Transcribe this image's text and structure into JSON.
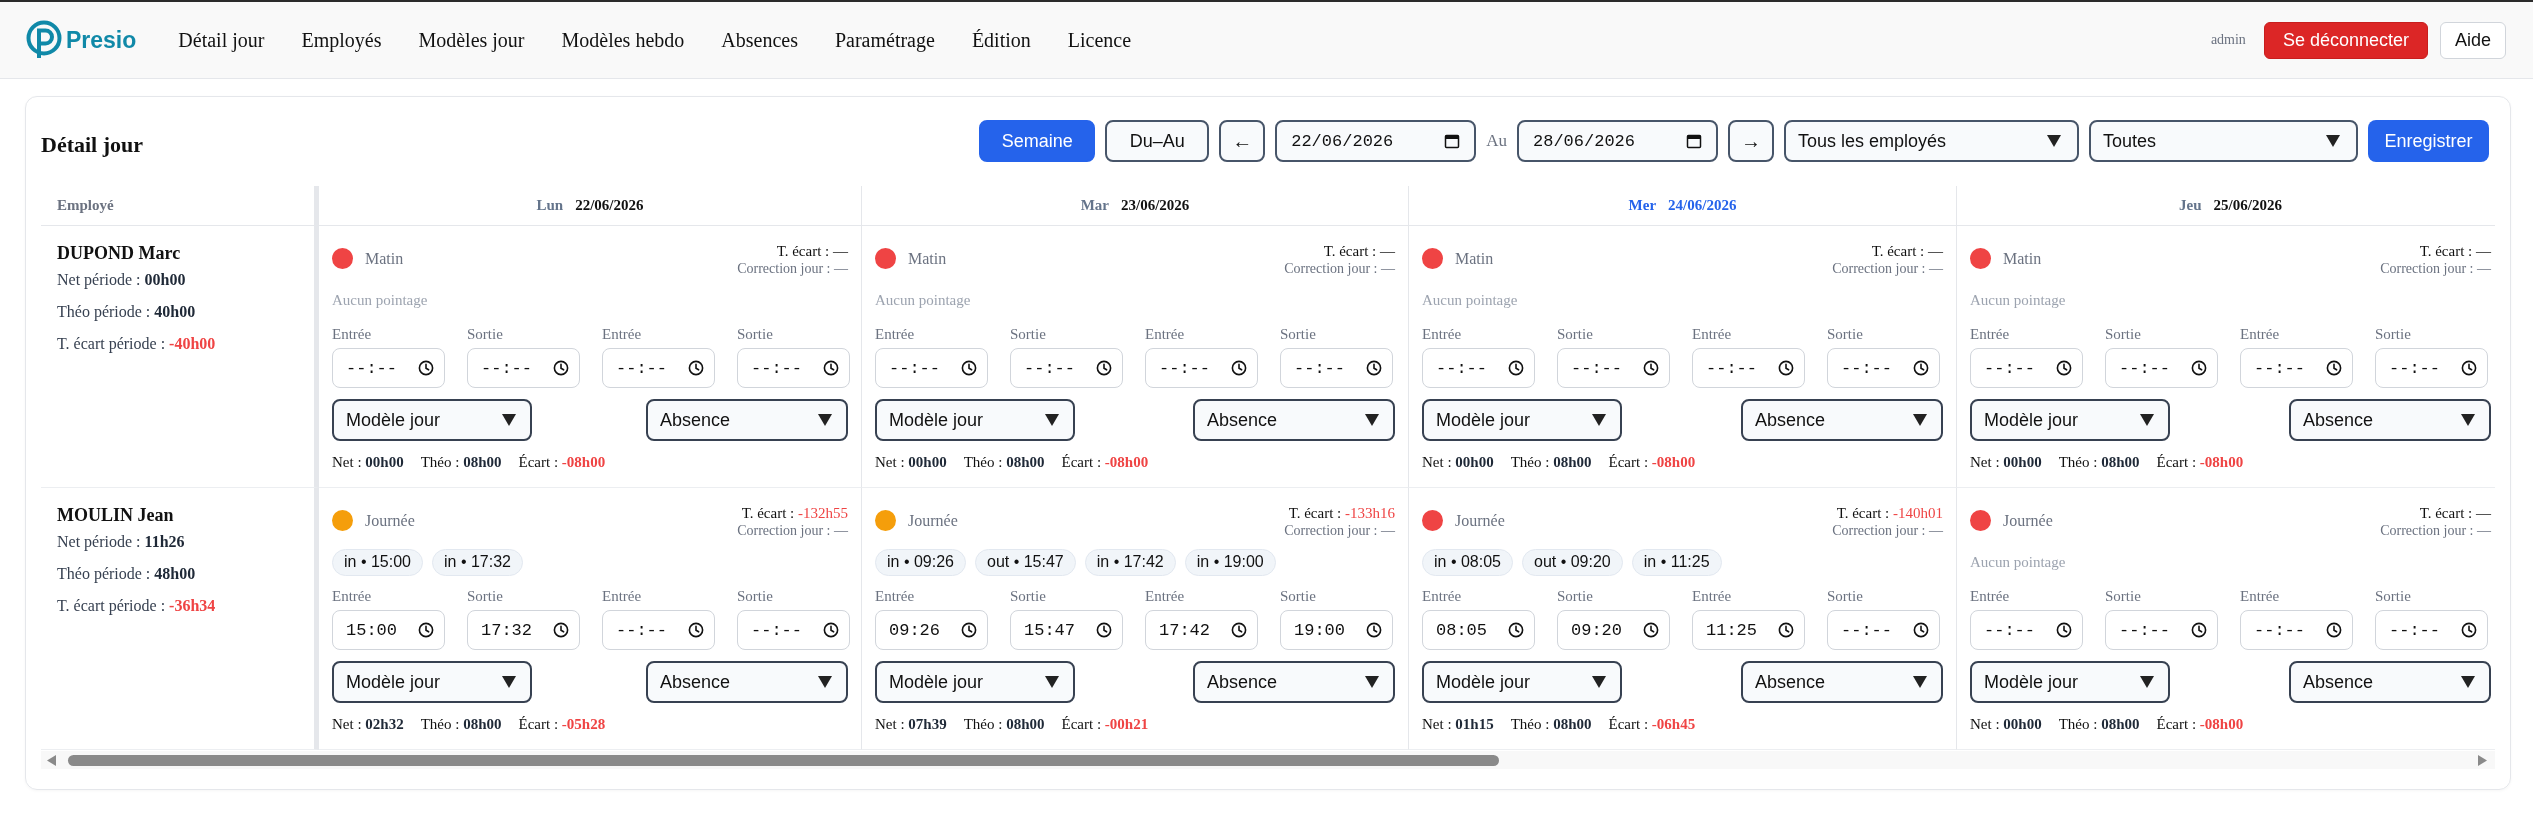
{
  "navbar": {
    "brand": "Presio",
    "links": [
      "Détail jour",
      "Employés",
      "Modèles jour",
      "Modèles hebdo",
      "Absences",
      "Paramétrage",
      "Édition",
      "Licence"
    ],
    "user": "admin",
    "logout_button": "Se déconnecter",
    "help_button": "Aide"
  },
  "page": {
    "title": "Détail jour",
    "mode_buttons": [
      {
        "label": "Semaine",
        "selected": true
      },
      {
        "label": "Du–Au",
        "selected": false
      }
    ],
    "prev_button": "←",
    "start_date": "22/06/2026",
    "range_separator": "Au",
    "end_date": "28/06/2026",
    "next_button": "→",
    "employee_filter": "Tous les employés",
    "category_filter": "Toutes",
    "save_button": "Enregistrer"
  },
  "table": {
    "employee_header": "Employé",
    "days": [
      {
        "weekday": "Lun",
        "date": "22/06/2026",
        "today": false
      },
      {
        "weekday": "Mar",
        "date": "23/06/2026",
        "today": false
      },
      {
        "weekday": "Mer",
        "date": "24/06/2026",
        "today": true
      },
      {
        "weekday": "Jeu",
        "date": "25/06/2026",
        "today": false
      }
    ],
    "rows": [
      {
        "name": "DUPOND Marc",
        "stats": [
          {
            "label": "Net période :",
            "value": "00h00",
            "negative": false
          },
          {
            "label": "Théo période :",
            "value": "40h00",
            "negative": false
          },
          {
            "label": "T. écart période :",
            "value": "-40h00",
            "negative": true
          }
        ],
        "cells": [
          {
            "color": "#ef4444",
            "shift": "Matin",
            "gap": {
              "label": "T. écart :",
              "value": "—",
              "negative": false
            },
            "correction": "Correction jour : —",
            "note": "Aucun pointage",
            "times": [
              {
                "label": "Entrée",
                "placeholder": "--:--"
              },
              {
                "label": "Sortie",
                "placeholder": "--:--"
              },
              {
                "label": "Entrée",
                "placeholder": "--:--"
              },
              {
                "label": "Sortie",
                "placeholder": "--:--"
              }
            ],
            "model": "Modèle jour",
            "absence": "Absence",
            "totals": [
              {
                "label": "Net :",
                "value": "00h00",
                "negative": false
              },
              {
                "label": "Théo :",
                "value": "08h00",
                "negative": false
              },
              {
                "label": "Écart :",
                "value": "-08h00",
                "negative": true
              }
            ]
          },
          {
            "color": "#ef4444",
            "shift": "Matin",
            "gap": {
              "label": "T. écart :",
              "value": "—",
              "negative": false
            },
            "correction": "Correction jour : —",
            "note": "Aucun pointage",
            "times": [
              {
                "label": "Entrée",
                "placeholder": "--:--"
              },
              {
                "label": "Sortie",
                "placeholder": "--:--"
              },
              {
                "label": "Entrée",
                "placeholder": "--:--"
              },
              {
                "label": "Sortie",
                "placeholder": "--:--"
              }
            ],
            "model": "Modèle jour",
            "absence": "Absence",
            "totals": [
              {
                "label": "Net :",
                "value": "00h00",
                "negative": false
              },
              {
                "label": "Théo :",
                "value": "08h00",
                "negative": false
              },
              {
                "label": "Écart :",
                "value": "-08h00",
                "negative": true
              }
            ]
          },
          {
            "color": "#ef4444",
            "shift": "Matin",
            "gap": {
              "label": "T. écart :",
              "value": "—",
              "negative": false
            },
            "correction": "Correction jour : —",
            "note": "Aucun pointage",
            "times": [
              {
                "label": "Entrée",
                "placeholder": "--:--"
              },
              {
                "label": "Sortie",
                "placeholder": "--:--"
              },
              {
                "label": "Entrée",
                "placeholder": "--:--"
              },
              {
                "label": "Sortie",
                "placeholder": "--:--"
              }
            ],
            "model": "Modèle jour",
            "absence": "Absence",
            "totals": [
              {
                "label": "Net :",
                "value": "00h00",
                "negative": false
              },
              {
                "label": "Théo :",
                "value": "08h00",
                "negative": false
              },
              {
                "label": "Écart :",
                "value": "-08h00",
                "negative": true
              }
            ]
          },
          {
            "color": "#ef4444",
            "shift": "Matin",
            "gap": {
              "label": "T. écart :",
              "value": "—",
              "negative": false
            },
            "correction": "Correction jour : —",
            "note": "Aucun pointage",
            "times": [
              {
                "label": "Entrée",
                "placeholder": "--:--"
              },
              {
                "label": "Sortie",
                "placeholder": "--:--"
              },
              {
                "label": "Entrée",
                "placeholder": "--:--"
              },
              {
                "label": "Sortie",
                "placeholder": "--:--"
              }
            ],
            "model": "Modèle jour",
            "absence": "Absence",
            "totals": [
              {
                "label": "Net :",
                "value": "00h00",
                "negative": false
              },
              {
                "label": "Théo :",
                "value": "08h00",
                "negative": false
              },
              {
                "label": "Écart :",
                "value": "-08h00",
                "negative": true
              }
            ]
          }
        ]
      },
      {
        "name": "MOULIN Jean",
        "stats": [
          {
            "label": "Net période :",
            "value": "11h26",
            "negative": false
          },
          {
            "label": "Théo période :",
            "value": "48h00",
            "negative": false
          },
          {
            "label": "T. écart période :",
            "value": "-36h34",
            "negative": true
          }
        ],
        "cells": [
          {
            "color": "#f59e0b",
            "shift": "Journée",
            "gap": {
              "label": "T. écart :",
              "value": "-132h55",
              "negative": true
            },
            "correction": "Correction jour : —",
            "punches": [
              "in • 15:00",
              "in • 17:32"
            ],
            "times": [
              {
                "label": "Entrée",
                "value": "15:00"
              },
              {
                "label": "Sortie",
                "value": "17:32"
              },
              {
                "label": "Entrée",
                "placeholder": "--:--"
              },
              {
                "label": "Sortie",
                "placeholder": "--:--"
              }
            ],
            "model": "Modèle jour",
            "absence": "Absence",
            "totals": [
              {
                "label": "Net :",
                "value": "02h32",
                "negative": false
              },
              {
                "label": "Théo :",
                "value": "08h00",
                "negative": false
              },
              {
                "label": "Écart :",
                "value": "-05h28",
                "negative": true
              }
            ]
          },
          {
            "color": "#f59e0b",
            "shift": "Journée",
            "gap": {
              "label": "T. écart :",
              "value": "-133h16",
              "negative": true
            },
            "correction": "Correction jour : —",
            "punches": [
              "in • 09:26",
              "out • 15:47",
              "in • 17:42",
              "in • 19:00"
            ],
            "times": [
              {
                "label": "Entrée",
                "value": "09:26"
              },
              {
                "label": "Sortie",
                "value": "15:47"
              },
              {
                "label": "Entrée",
                "value": "17:42"
              },
              {
                "label": "Sortie",
                "value": "19:00"
              }
            ],
            "model": "Modèle jour",
            "absence": "Absence",
            "totals": [
              {
                "label": "Net :",
                "value": "07h39",
                "negative": false
              },
              {
                "label": "Théo :",
                "value": "08h00",
                "negative": false
              },
              {
                "label": "Écart :",
                "value": "-00h21",
                "negative": true
              }
            ]
          },
          {
            "color": "#ef4444",
            "shift": "Journée",
            "gap": {
              "label": "T. écart :",
              "value": "-140h01",
              "negative": true
            },
            "correction": "Correction jour : —",
            "punches": [
              "in • 08:05",
              "out • 09:20",
              "in • 11:25"
            ],
            "times": [
              {
                "label": "Entrée",
                "value": "08:05"
              },
              {
                "label": "Sortie",
                "value": "09:20"
              },
              {
                "label": "Entrée",
                "value": "11:25"
              },
              {
                "label": "Sortie",
                "placeholder": "--:--"
              }
            ],
            "model": "Modèle jour",
            "absence": "Absence",
            "totals": [
              {
                "label": "Net :",
                "value": "01h15",
                "negative": false
              },
              {
                "label": "Théo :",
                "value": "08h00",
                "negative": false
              },
              {
                "label": "Écart :",
                "value": "-06h45",
                "negative": true
              }
            ]
          },
          {
            "color": "#ef4444",
            "shift": "Journée",
            "gap": {
              "label": "T. écart :",
              "value": "—",
              "negative": false
            },
            "correction": "Correction jour : —",
            "note": "Aucun pointage",
            "times": [
              {
                "label": "Entrée",
                "placeholder": "--:--"
              },
              {
                "label": "Sortie",
                "placeholder": "--:--"
              },
              {
                "label": "Entrée",
                "placeholder": "--:--"
              },
              {
                "label": "Sortie",
                "placeholder": "--:--"
              }
            ],
            "model": "Modèle jour",
            "absence": "Absence",
            "totals": [
              {
                "label": "Net :",
                "value": "00h00",
                "negative": false
              },
              {
                "label": "Théo :",
                "value": "08h00",
                "negative": false
              },
              {
                "label": "Écart :",
                "value": "-08h00",
                "negative": true
              }
            ]
          }
        ]
      }
    ]
  }
}
